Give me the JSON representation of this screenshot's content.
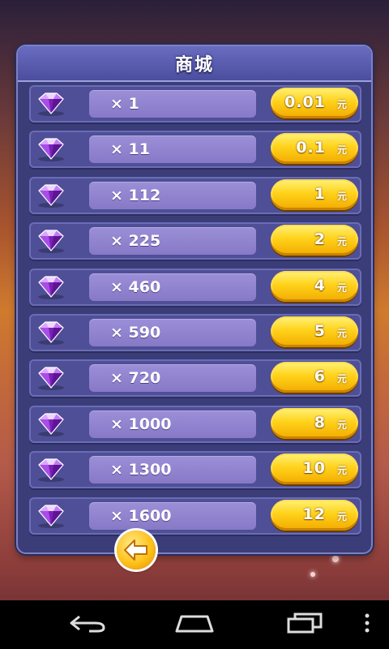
{
  "shop": {
    "title": "商城",
    "items": [
      {
        "qty": "× 1",
        "price": "0.01",
        "unit": "元"
      },
      {
        "qty": "× 11",
        "price": "0.1",
        "unit": "元"
      },
      {
        "qty": "× 112",
        "price": "1",
        "unit": "元"
      },
      {
        "qty": "× 225",
        "price": "2",
        "unit": "元"
      },
      {
        "qty": "× 460",
        "price": "4",
        "unit": "元"
      },
      {
        "qty": "× 590",
        "price": "5",
        "unit": "元"
      },
      {
        "qty": "× 720",
        "price": "6",
        "unit": "元"
      },
      {
        "qty": "× 1000",
        "price": "8",
        "unit": "元"
      },
      {
        "qty": "× 1300",
        "price": "10",
        "unit": "元"
      },
      {
        "qty": "× 1600",
        "price": "12",
        "unit": "元"
      }
    ]
  },
  "icons": {
    "gem": "purple-gem-icon",
    "back": "back-arrow-icon",
    "nav_back": "nav-back-icon",
    "nav_home": "nav-home-icon",
    "nav_recents": "nav-recents-icon",
    "nav_menu": "nav-menu-icon"
  },
  "colors": {
    "panel": "#3a3d78",
    "row": "#4e4f96",
    "qty_box": "#8f82cd",
    "price_button": "#ffd21a"
  }
}
